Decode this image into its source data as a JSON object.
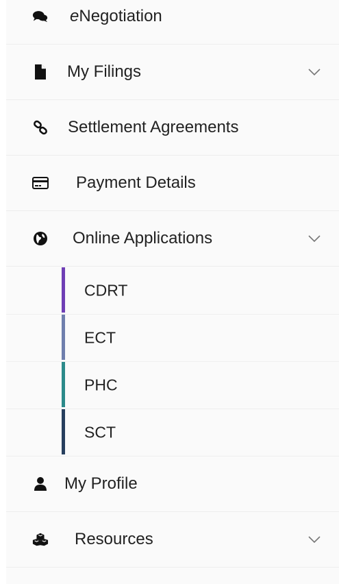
{
  "menu": {
    "enegotiation": {
      "prefix": "e",
      "rest": "Negotiation",
      "icon": "comments-icon"
    },
    "my_filings": {
      "label": "My Filings",
      "icon": "file-icon",
      "expandable": true
    },
    "settlement_agreements": {
      "label": "Settlement Agreements",
      "icon": "link-icon"
    },
    "payment_details": {
      "label": "Payment Details",
      "icon": "credit-card-icon"
    },
    "online_applications": {
      "label": "Online Applications",
      "icon": "globe-icon",
      "expandable": true,
      "children": [
        {
          "label": "CDRT",
          "accent": "#6f3fb5"
        },
        {
          "label": "ECT",
          "accent": "#6f7fad"
        },
        {
          "label": "PHC",
          "accent": "#2c8a8a"
        },
        {
          "label": "SCT",
          "accent": "#273f5e"
        }
      ]
    },
    "my_profile": {
      "label": "My Profile",
      "icon": "user-icon"
    },
    "resources": {
      "label": "Resources",
      "icon": "cubes-icon",
      "expandable": true
    }
  }
}
